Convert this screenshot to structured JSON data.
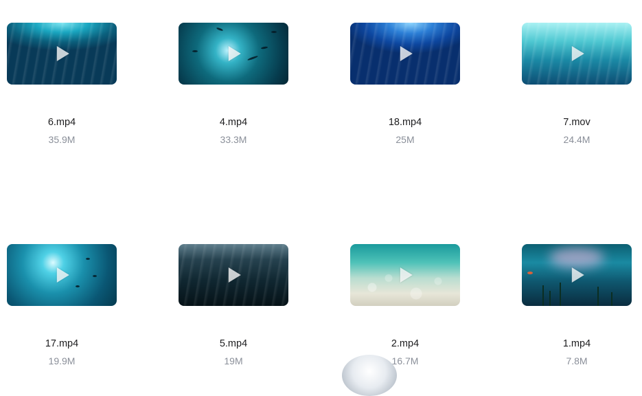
{
  "files": [
    {
      "name": "6.mp4",
      "size": "35.9M",
      "icon": "play-icon"
    },
    {
      "name": "4.mp4",
      "size": "33.3M",
      "icon": "play-icon"
    },
    {
      "name": "18.mp4",
      "size": "25M",
      "icon": "play-icon"
    },
    {
      "name": "7.mov",
      "size": "24.4M",
      "icon": "play-icon"
    },
    {
      "name": "17.mp4",
      "size": "19.9M",
      "icon": "play-icon"
    },
    {
      "name": "5.mp4",
      "size": "19M",
      "icon": "play-icon"
    },
    {
      "name": "2.mp4",
      "size": "16.7M",
      "icon": "play-icon"
    },
    {
      "name": "1.mp4",
      "size": "7.8M",
      "icon": "play-icon"
    }
  ]
}
